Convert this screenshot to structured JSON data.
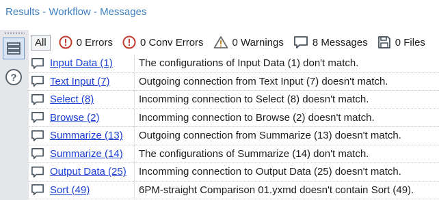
{
  "window": {
    "title": "Results - Workflow - Messages"
  },
  "toolbar": {
    "all_label": "All",
    "errors_label": "0 Errors",
    "conv_errors_label": "0 Conv Errors",
    "warnings_label": "0 Warnings",
    "messages_label": "8 Messages",
    "files_label": "0 Files"
  },
  "rows": [
    {
      "tool": "Input Data (1)",
      "message": "The configurations of Input Data (1) don't match."
    },
    {
      "tool": "Text Input (7)",
      "message": "Outgoing connection from Text Input (7) doesn't match."
    },
    {
      "tool": "Select (8)",
      "message": "Incomming connection to Select (8) doesn't match."
    },
    {
      "tool": "Browse (2)",
      "message": "Incomming connection to Browse (2) doesn't match."
    },
    {
      "tool": "Summarize (13)",
      "message": "Outgoing connection from Summarize (13) doesn't match."
    },
    {
      "tool": "Summarize (14)",
      "message": "The configurations of Summarize (14) don't match."
    },
    {
      "tool": "Output Data (25)",
      "message": "Incomming connection to Output Data (25) doesn't match."
    },
    {
      "tool": "Sort (49)",
      "message": "6PM-straight Comparison 01.yxmd doesn't contain Sort (49)."
    }
  ],
  "colors": {
    "title": "#3d7fc0",
    "link": "#1a3fd6",
    "error_icon": "#c0392b"
  }
}
